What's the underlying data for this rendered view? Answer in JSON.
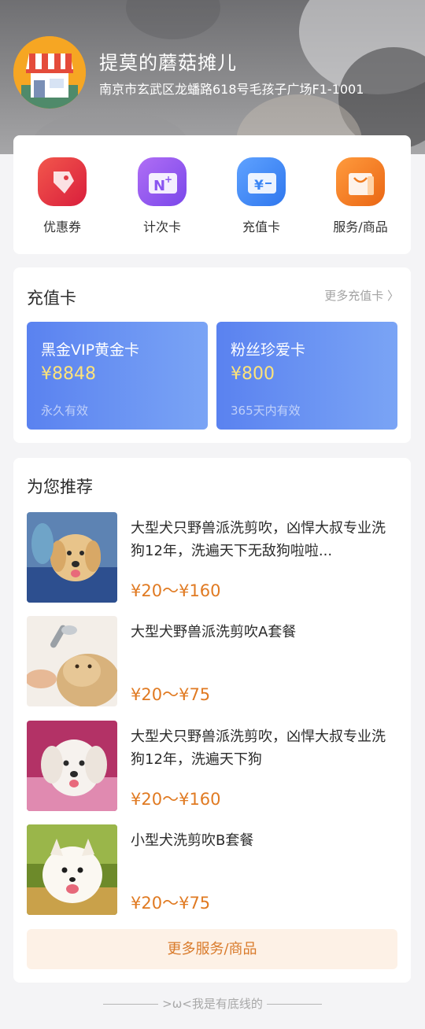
{
  "shop": {
    "name": "提莫的蘑菇摊儿",
    "address": "南京市玄武区龙蟠路618号毛孩子广场F1-1001"
  },
  "menu": {
    "items": [
      {
        "label": "优惠券",
        "icon": "coupon-icon",
        "color": "#e8313f"
      },
      {
        "label": "计次卡",
        "icon": "count-card-icon",
        "color": "#8b55f2"
      },
      {
        "label": "充值卡",
        "icon": "recharge-card-icon",
        "color": "#3b86f5"
      },
      {
        "label": "服务/商品",
        "icon": "shopping-bag-icon",
        "color": "#f07a1e"
      }
    ]
  },
  "recharge": {
    "title": "充值卡",
    "more": "更多充值卡 〉",
    "cards": [
      {
        "name": "黑金VIP黄金卡",
        "price": "¥8848",
        "validity": "永久有效"
      },
      {
        "name": "粉丝珍爱卡",
        "price": "¥800",
        "validity": "365天内有效"
      }
    ]
  },
  "recommend": {
    "title": "为您推荐",
    "items": [
      {
        "title": "大型犬只野兽派洗剪吹，凶悍大叔专业洗狗12年，洗遍天下无敌狗啦啦...",
        "price": "¥20～¥160",
        "image": "golden-retriever-photo"
      },
      {
        "title": "大型犬野兽派洗剪吹A套餐",
        "price": "¥20～¥75",
        "image": "dog-bath-photo"
      },
      {
        "title": "大型犬只野兽派洗剪吹，凶悍大叔专业洗狗12年，洗遍天下狗",
        "price": "¥20～¥160",
        "image": "white-fluffy-dog-photo"
      },
      {
        "title": "小型犬洗剪吹B套餐",
        "price": "¥20～¥75",
        "image": "pomeranian-photo"
      }
    ],
    "more_button": "更多服务/商品"
  },
  "footer": {
    "note": ">ω<我是有底线的"
  },
  "colors": {
    "price": "#e07a22",
    "card_gradient_start": "#5a82f0",
    "card_gradient_end": "#7aa4f5",
    "card_price": "#fde37a"
  }
}
